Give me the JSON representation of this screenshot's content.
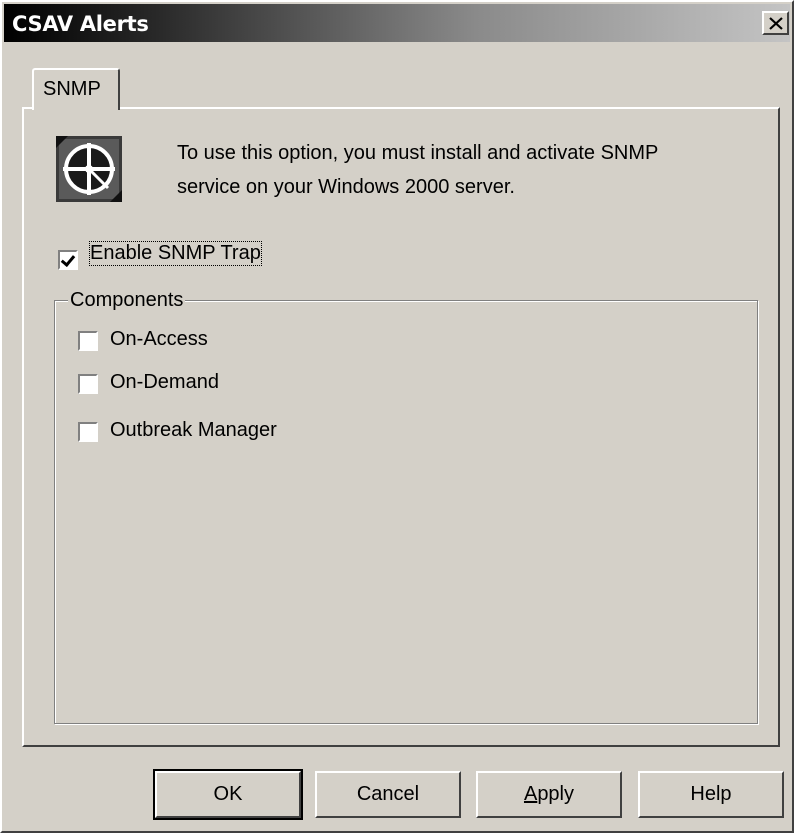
{
  "window": {
    "title": "CSAV Alerts",
    "close_symbol": "✕"
  },
  "tabs": [
    {
      "label": "SNMP",
      "active": true
    }
  ],
  "info": {
    "icon": "snmp-network-icon",
    "line1": "To use this option, you must install and activate SNMP",
    "line2": "service on your Windows 2000 server."
  },
  "enable_trap": {
    "label": "Enable SNMP Trap",
    "checked": true
  },
  "components": {
    "title": "Components",
    "items": [
      {
        "label": "On-Access",
        "checked": false
      },
      {
        "label": "On-Demand",
        "checked": false
      },
      {
        "label": "Outbreak Manager",
        "checked": false
      }
    ]
  },
  "buttons": {
    "ok": "OK",
    "cancel": "Cancel",
    "apply_mnemonic": "A",
    "apply_rest": "pply",
    "help": "Help"
  }
}
